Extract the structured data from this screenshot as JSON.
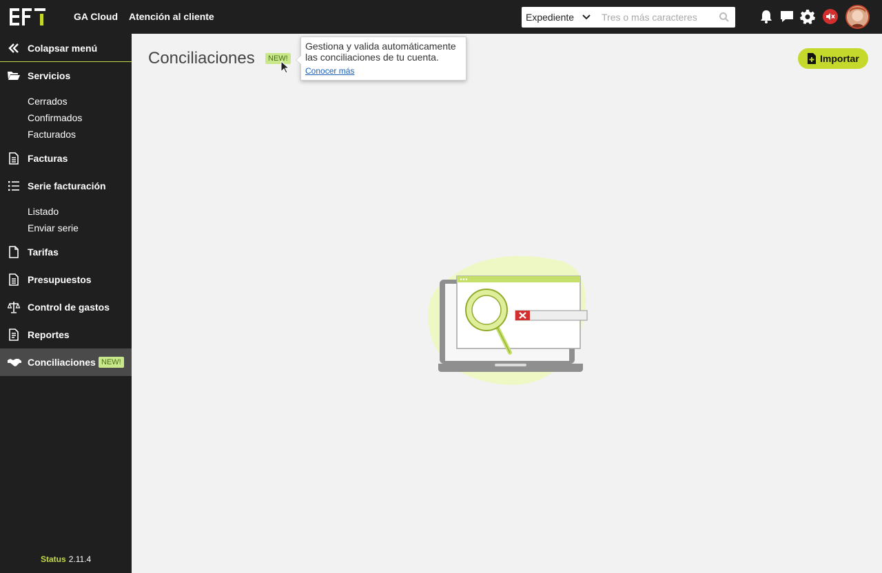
{
  "header": {
    "logo_alt": "EFI",
    "nav": [
      {
        "label": "GA Cloud"
      },
      {
        "label": "Atención al cliente"
      }
    ],
    "search": {
      "selected_option": "Expediente",
      "placeholder": "Tres o más caracteres"
    },
    "icons": [
      "bell-icon",
      "chat-icon",
      "gear-icon",
      "sound-off-icon",
      "avatar"
    ]
  },
  "sidebar": {
    "collapse_label": "Colapsar menú",
    "sections": [
      {
        "label": "Servicios",
        "icon": "folder-icon",
        "children": [
          "Cerrados",
          "Confirmados",
          "Facturados"
        ]
      },
      {
        "label": "Facturas",
        "icon": "document-icon"
      },
      {
        "label": "Serie facturación",
        "icon": "list-icon",
        "children": [
          "Listado",
          "Enviar serie"
        ]
      },
      {
        "label": "Tarifas",
        "icon": "file-icon"
      },
      {
        "label": "Presupuestos",
        "icon": "document-icon"
      },
      {
        "label": "Control de gastos",
        "icon": "scale-icon"
      },
      {
        "label": "Reportes",
        "icon": "report-icon"
      },
      {
        "label": "Conciliaciones",
        "icon": "handshake-icon",
        "badge": "NEW!",
        "active": true
      }
    ],
    "status_label": "Status",
    "version": "2.11.4"
  },
  "main": {
    "title": "Conciliaciones",
    "title_badge": "NEW!",
    "tooltip": {
      "text": "Gestiona y valida automáticamente las conciliaciones de tu cuenta.",
      "link": "Conocer más"
    },
    "import_label": "Importar"
  },
  "colors": {
    "accent": "#c4d92b",
    "topbar": "#1f1f1f",
    "sidebar": "#1f1f1f",
    "active_item": "#4a4a4a",
    "badge_bg": "#c9e88a",
    "background": "#f2f2f2"
  }
}
